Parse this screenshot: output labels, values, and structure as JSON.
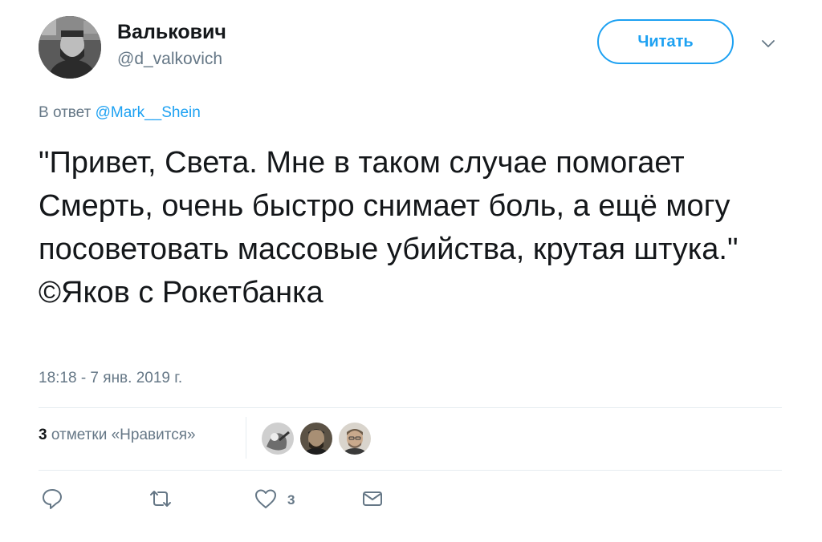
{
  "author": {
    "display_name": "Валькович",
    "handle": "@d_valkovich"
  },
  "follow_button_label": "Читать",
  "reply": {
    "prefix": "В ответ ",
    "mention": "@Mark__Shein"
  },
  "tweet_text": "\"Привет, Света. Мне в таком случае помогает Смерть, очень быстро снимает боль, а ещё могу посоветовать массовые убийства, крутая штука.\" ©Яков с Рокетбанка",
  "timestamp": "18:18 - 7 янв. 2019 г.",
  "likes": {
    "count": "3",
    "label": " отметки «Нравится»"
  },
  "actions": {
    "reply_count": "",
    "retweet_count": "",
    "like_count": "3"
  },
  "colors": {
    "accent": "#1da1f2",
    "secondary_text": "#657786",
    "divider": "#e6ecf0"
  },
  "icons": [
    "reply-icon",
    "retweet-icon",
    "heart-icon",
    "message-icon",
    "chevron-down-icon"
  ]
}
